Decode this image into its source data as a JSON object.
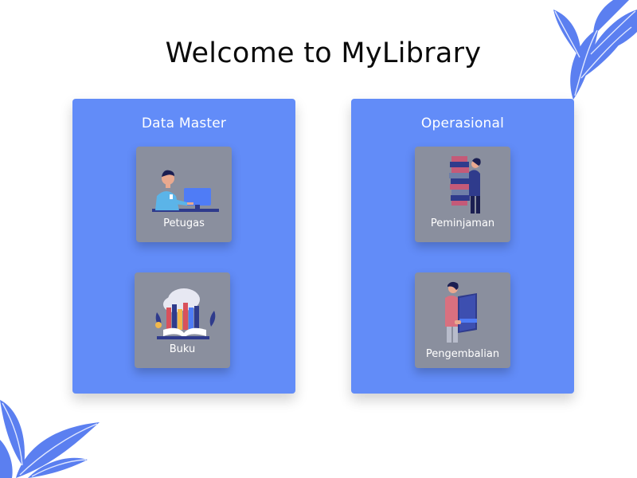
{
  "page": {
    "title": "Welcome to MyLibrary"
  },
  "panels": [
    {
      "title": "Data Master",
      "cards": [
        {
          "label": "Petugas",
          "icon": "officer-at-computer-icon"
        },
        {
          "label": "Buku",
          "icon": "books-stack-icon"
        }
      ]
    },
    {
      "title": "Operasional",
      "cards": [
        {
          "label": "Peminjaman",
          "icon": "person-carrying-books-icon"
        },
        {
          "label": "Pengembalian",
          "icon": "person-holding-book-icon"
        }
      ]
    }
  ],
  "colors": {
    "panel": "#628cf8",
    "card": "#8a8f9e",
    "leaf": "#5b7ff0",
    "title": "#0b0b0b"
  }
}
